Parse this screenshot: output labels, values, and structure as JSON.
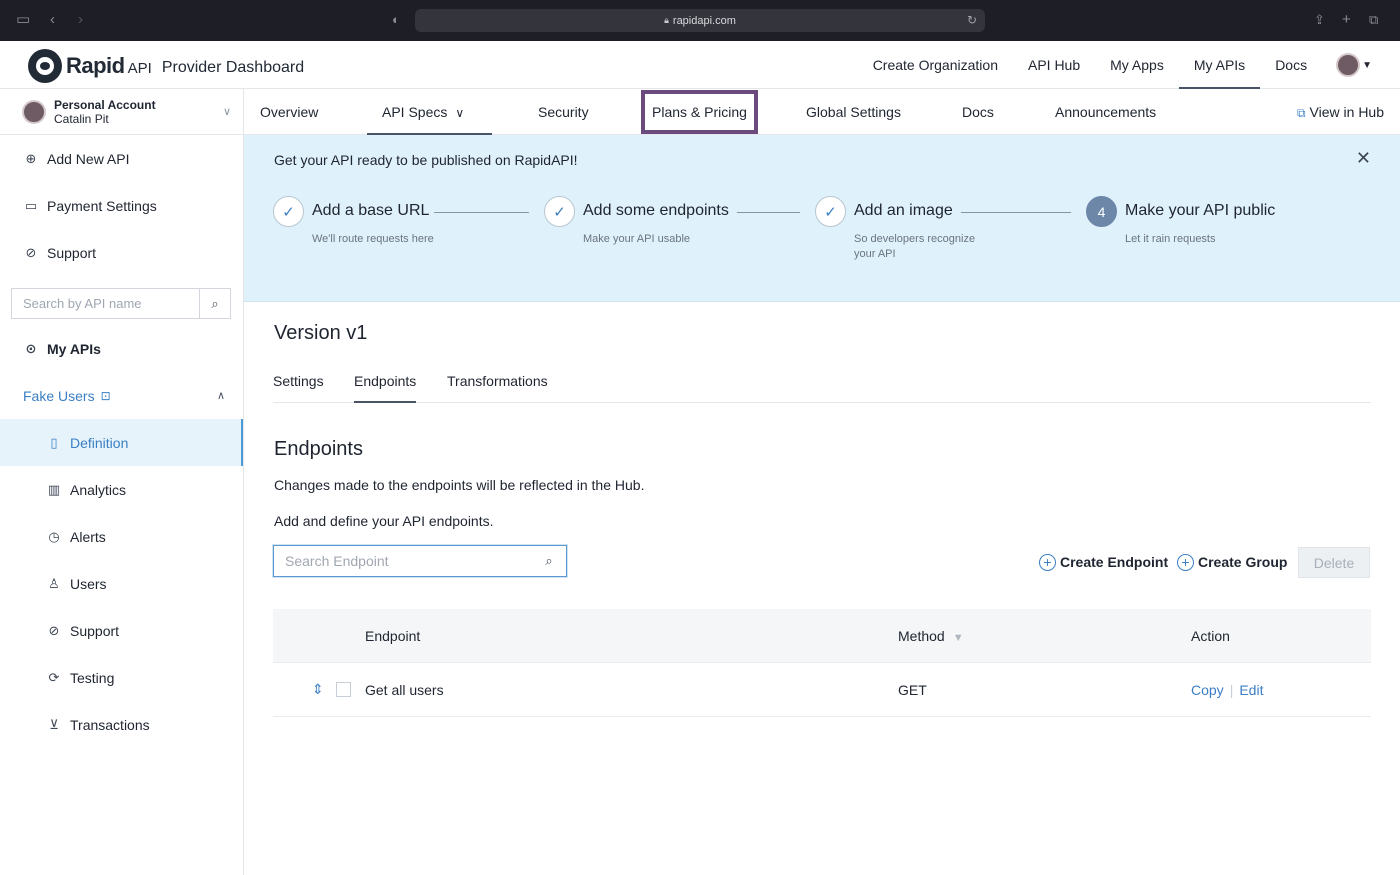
{
  "browser": {
    "url": "rapidapi.com"
  },
  "brand": {
    "name": "Rapid",
    "suffix": "API",
    "title": "Provider Dashboard"
  },
  "topnav": {
    "items": [
      "Create Organization",
      "API Hub",
      "My Apps",
      "My APIs",
      "Docs"
    ],
    "active": "My APIs"
  },
  "account": {
    "name": "Personal Account",
    "user": "Catalin Pit"
  },
  "sidebar": {
    "add_api": "Add New API",
    "payment": "Payment Settings",
    "support": "Support",
    "search_placeholder": "Search by API name",
    "my_apis": "My APIs",
    "api_name": "Fake Users",
    "sub_items": [
      "Definition",
      "Analytics",
      "Alerts",
      "Users",
      "Support",
      "Testing",
      "Transactions"
    ],
    "active_sub": "Definition"
  },
  "subnav": {
    "tabs": [
      "Overview",
      "API Specs",
      "Security",
      "Plans & Pricing",
      "Global Settings",
      "Docs",
      "Announcements"
    ],
    "active": "API Specs",
    "highlighted": "Plans & Pricing",
    "view_in_hub": "View in Hub"
  },
  "banner": {
    "title": "Get your API ready to be published on RapidAPI!",
    "steps": [
      {
        "title": "Add a base URL",
        "desc": "We'll route requests here",
        "done": true
      },
      {
        "title": "Add some endpoints",
        "desc": "Make your API usable",
        "done": true
      },
      {
        "title": "Add an image",
        "desc": "So developers recognize",
        "desc2": "your API",
        "done": true
      },
      {
        "title": "Make your API public",
        "desc": "Let it rain requests",
        "number": "4",
        "done": false
      }
    ]
  },
  "version": {
    "title": "Version v1",
    "tabs": [
      "Settings",
      "Endpoints",
      "Transformations"
    ],
    "active_tab": "Endpoints"
  },
  "endpoints": {
    "title": "Endpoints",
    "desc1": "Changes made to the endpoints will be reflected in the Hub.",
    "desc2": "Add and define your API endpoints.",
    "search_placeholder": "Search Endpoint",
    "create_endpoint": "Create Endpoint",
    "create_group": "Create Group",
    "delete": "Delete",
    "columns": {
      "endpoint": "Endpoint",
      "method": "Method",
      "action": "Action"
    },
    "rows": [
      {
        "name": "Get all users",
        "method": "GET",
        "copy": "Copy",
        "edit": "Edit"
      }
    ]
  },
  "colors": {
    "accent": "#3b7fc4",
    "banner_bg": "#dff1fb",
    "highlight_border": "#6b4a7d"
  }
}
